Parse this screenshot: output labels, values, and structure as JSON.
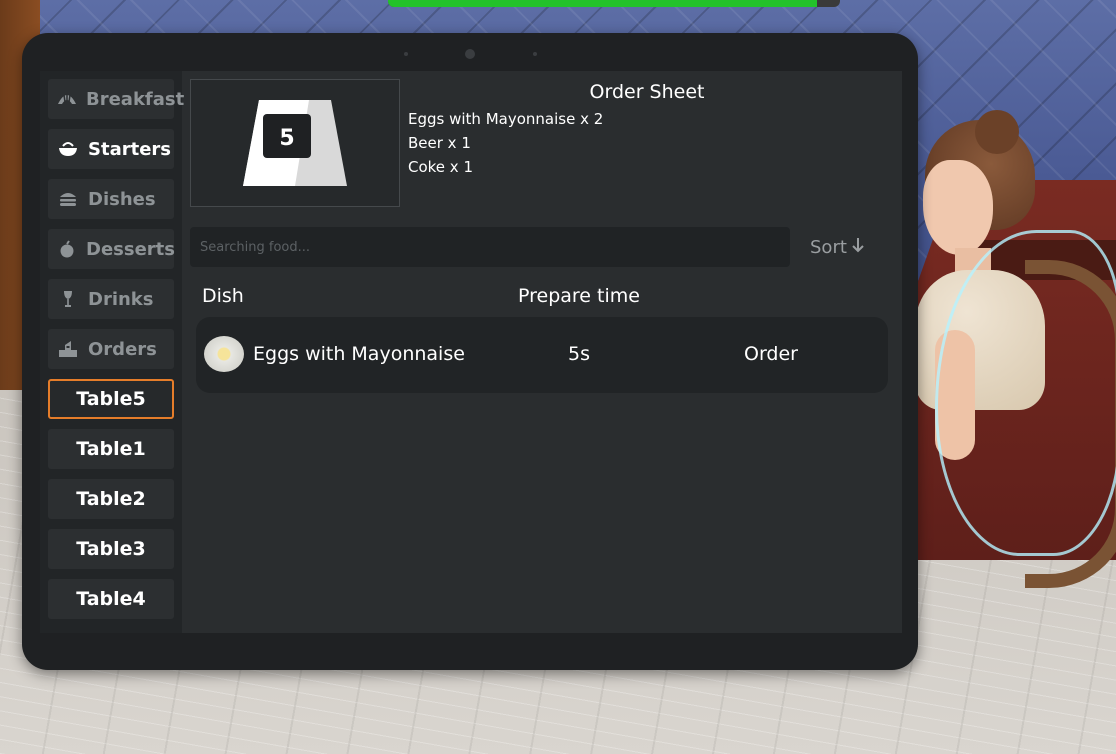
{
  "hud": {
    "progress_fraction": 0.95,
    "progress_color": "#23c22a"
  },
  "sidebar": {
    "categories": [
      {
        "label": "Breakfast",
        "icon": "croissant-icon",
        "active": false
      },
      {
        "label": "Starters",
        "icon": "bowl-icon",
        "active": true
      },
      {
        "label": "Dishes",
        "icon": "burger-icon",
        "active": false
      },
      {
        "label": "Desserts",
        "icon": "apple-icon",
        "active": false
      },
      {
        "label": "Drinks",
        "icon": "wine-glass-icon",
        "active": false
      },
      {
        "label": "Orders",
        "icon": "orders-icon",
        "active": false
      }
    ],
    "tables": [
      {
        "label": "Table5",
        "selected": true
      },
      {
        "label": "Table1",
        "selected": false
      },
      {
        "label": "Table2",
        "selected": false
      },
      {
        "label": "Table3",
        "selected": false
      },
      {
        "label": "Table4",
        "selected": false
      }
    ],
    "selected_color": "#e57d2a"
  },
  "order_sheet": {
    "title": "Order Sheet",
    "table_number": "5",
    "items": [
      "Eggs with Mayonnaise x 2",
      "Beer x 1",
      "Coke x 1"
    ]
  },
  "search": {
    "placeholder": "Searching food...",
    "value": ""
  },
  "sort": {
    "label": "Sort",
    "icon": "arrow-down-icon"
  },
  "dish_table": {
    "columns": [
      "Dish",
      "Prepare time"
    ],
    "rows": [
      {
        "name": "Eggs with Mayonnaise",
        "prepare_time": "5s",
        "action": "Order",
        "thumb": "eggs-plate-icon"
      }
    ]
  }
}
